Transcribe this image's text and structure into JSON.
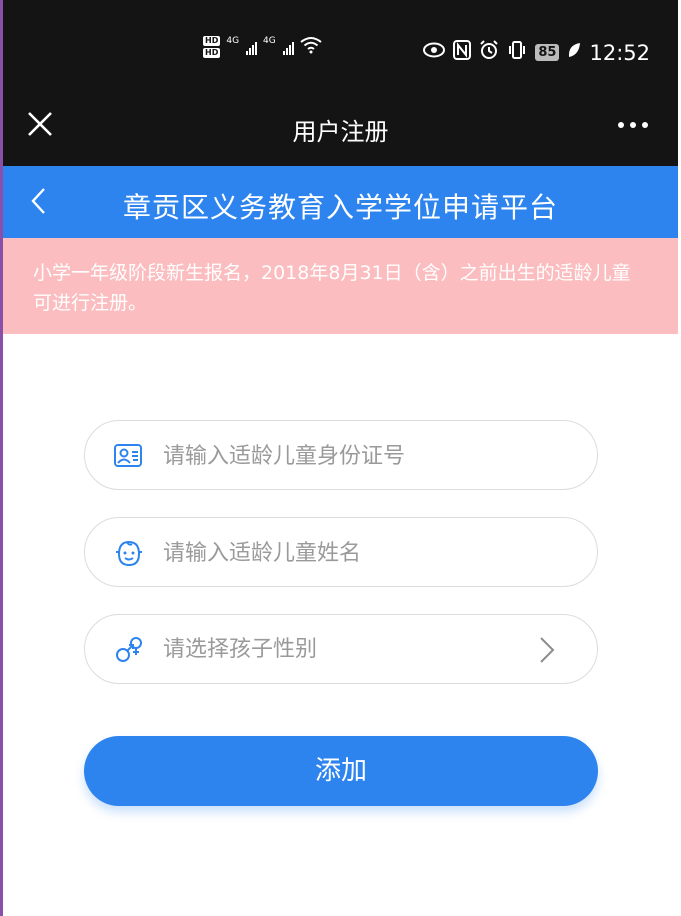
{
  "statusbar": {
    "hd1": "HD",
    "hd2": "HD",
    "net1": "4G",
    "net2": "4G",
    "battery": "85",
    "time": "12:52"
  },
  "titlebar": {
    "title": "用户注册"
  },
  "header": {
    "title": "章贡区义务教育入学学位申请平台"
  },
  "notice": {
    "text": "小学一年级阶段新生报名，2018年8月31日（含）之前出生的适龄儿童可进行注册。"
  },
  "form": {
    "id_placeholder": "请输入适龄儿童身份证号",
    "name_placeholder": "请输入适龄儿童姓名",
    "gender_placeholder": "请选择孩子性别",
    "submit_label": "添加"
  },
  "colors": {
    "brand_blue": "#2d84ee",
    "notice_bg": "#fbbdbf",
    "dark_bar": "#141414"
  }
}
